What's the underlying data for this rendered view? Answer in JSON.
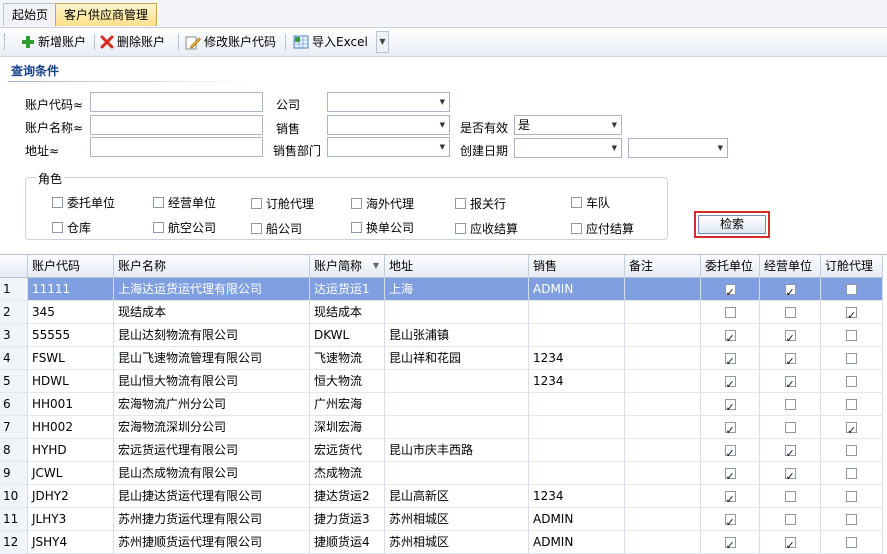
{
  "tabs": [
    {
      "label": "起始页"
    },
    {
      "label": "客户供应商管理"
    }
  ],
  "toolbar": {
    "add": "新增账户",
    "delete": "删除账户",
    "edit": "修改账户代码",
    "import": "导入Excel"
  },
  "query": {
    "title": "查询条件",
    "account_code_label": "账户代码≈",
    "account_name_label": "账户名称≈",
    "address_label": "地址≈",
    "company_label": "公司",
    "sales_label": "销售",
    "sales_dept_label": "销售部门",
    "valid_label": "是否有效",
    "valid_value": "是",
    "created_label": "创建日期",
    "roles_title": "角色",
    "roles": [
      "委托单位",
      "经营单位",
      "订舱代理",
      "海外代理",
      "报关行",
      "车队",
      "仓库",
      "航空公司",
      "船公司",
      "换单公司",
      "应收结算",
      "应付结算"
    ],
    "search_button": "检索"
  },
  "grid": {
    "headers": [
      "",
      "账户代码",
      "账户名称",
      "账户简称",
      "地址",
      "销售",
      "备注",
      "委托单位",
      "经营单位",
      "订舱代理"
    ],
    "rows": [
      {
        "n": "1",
        "code": "11111",
        "name": "上海达运货运代理有限公司",
        "short": "达运货运1",
        "addr": "上海",
        "sales": "ADMIN",
        "note": "",
        "c1": true,
        "c2": true,
        "c3": false
      },
      {
        "n": "2",
        "code": "345",
        "name": "现结成本",
        "short": "现结成本",
        "addr": "",
        "sales": "",
        "note": "",
        "c1": false,
        "c2": false,
        "c3": true
      },
      {
        "n": "3",
        "code": "55555",
        "name": "昆山达刻物流有限公司",
        "short": "DKWL",
        "addr": "昆山张浦镇",
        "sales": "",
        "note": "",
        "c1": true,
        "c2": true,
        "c3": false
      },
      {
        "n": "4",
        "code": "FSWL",
        "name": "昆山飞速物流管理有限公司",
        "short": "飞速物流",
        "addr": "昆山祥和花园",
        "sales": "1234",
        "note": "",
        "c1": true,
        "c2": true,
        "c3": false
      },
      {
        "n": "5",
        "code": "HDWL",
        "name": "昆山恒大物流有限公司",
        "short": "恒大物流",
        "addr": "",
        "sales": "1234",
        "note": "",
        "c1": true,
        "c2": true,
        "c3": false
      },
      {
        "n": "6",
        "code": "HH001",
        "name": "宏海物流广州分公司",
        "short": "广州宏海",
        "addr": "",
        "sales": "",
        "note": "",
        "c1": true,
        "c2": false,
        "c3": false
      },
      {
        "n": "7",
        "code": "HH002",
        "name": "宏海物流深圳分公司",
        "short": "深圳宏海",
        "addr": "",
        "sales": "",
        "note": "",
        "c1": true,
        "c2": false,
        "c3": true
      },
      {
        "n": "8",
        "code": "HYHD",
        "name": "宏远货运代理有限公司",
        "short": "宏远货代",
        "addr": "昆山市庆丰西路",
        "sales": "",
        "note": "",
        "c1": true,
        "c2": true,
        "c3": false
      },
      {
        "n": "9",
        "code": "JCWL",
        "name": "昆山杰成物流有限公司",
        "short": "杰成物流",
        "addr": "",
        "sales": "",
        "note": "",
        "c1": true,
        "c2": true,
        "c3": false
      },
      {
        "n": "10",
        "code": "JDHY2",
        "name": "昆山捷达货运代理有限公司",
        "short": "捷达货运2",
        "addr": "昆山高新区",
        "sales": "1234",
        "note": "",
        "c1": true,
        "c2": false,
        "c3": false
      },
      {
        "n": "11",
        "code": "JLHY3",
        "name": "苏州捷力货运代理有限公司",
        "short": "捷力货运3",
        "addr": "苏州相城区",
        "sales": "ADMIN",
        "note": "",
        "c1": true,
        "c2": false,
        "c3": false
      },
      {
        "n": "12",
        "code": "JSHY4",
        "name": "苏州捷顺货运代理有限公司",
        "short": "捷顺货运4",
        "addr": "苏州相城区",
        "sales": "ADMIN",
        "note": "",
        "c1": true,
        "c2": true,
        "c3": false
      }
    ]
  }
}
